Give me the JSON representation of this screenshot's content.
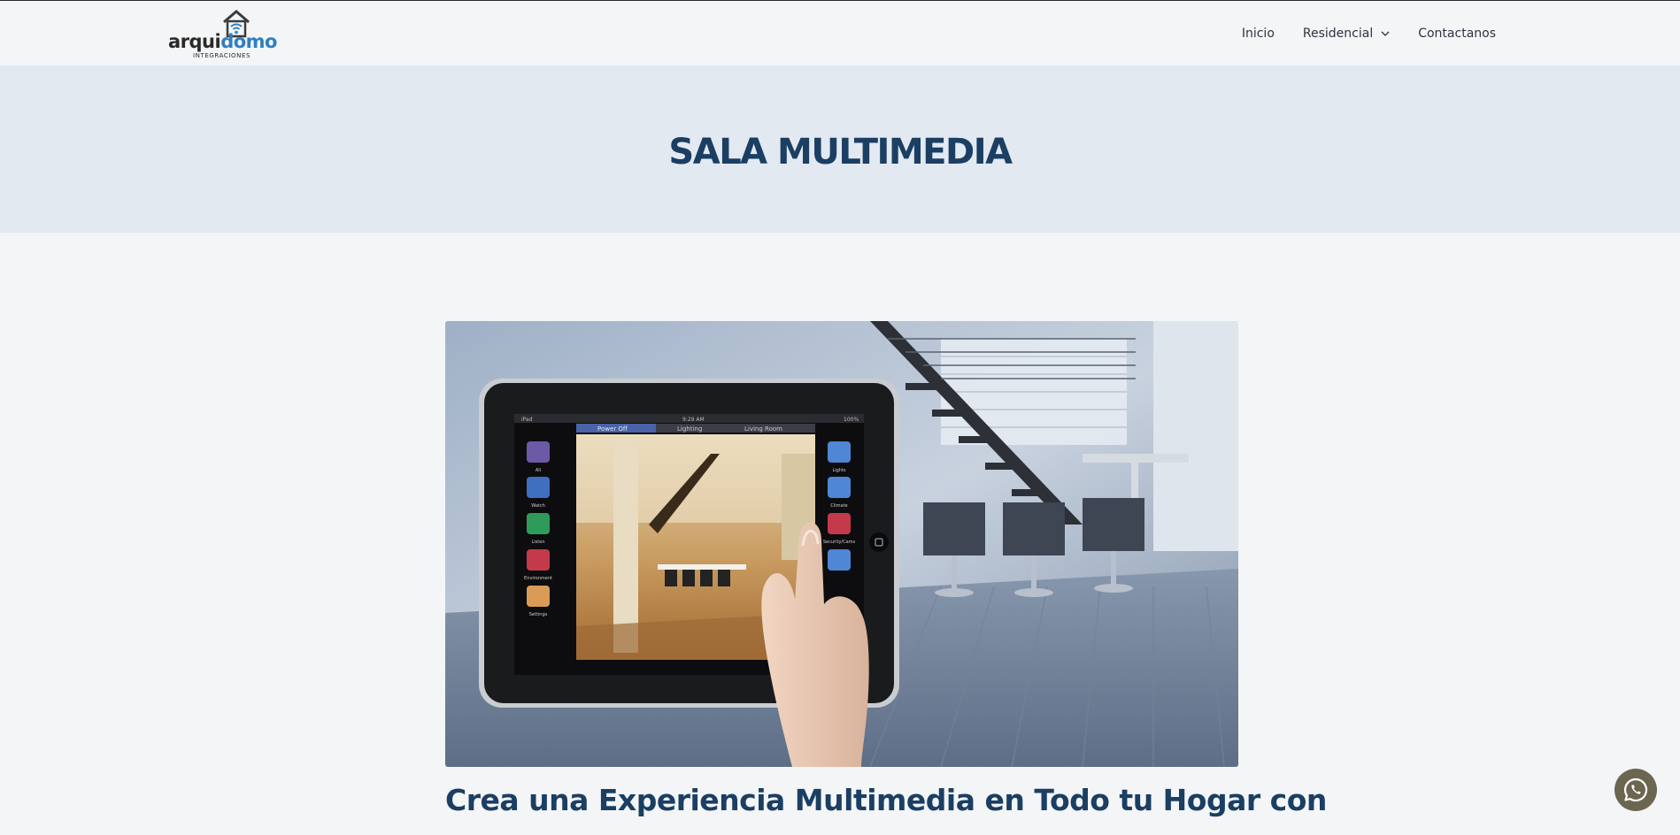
{
  "brand": {
    "name_part1": "arqui",
    "name_part2": "domo",
    "tagline": "INTEGRACIONES",
    "icon": "house-wifi-icon"
  },
  "nav": {
    "items": [
      {
        "label": "Inicio"
      },
      {
        "label": "Residencial",
        "has_dropdown": true
      },
      {
        "label": "Contactanos"
      }
    ]
  },
  "hero": {
    "title": "SALA MULTIMEDIA"
  },
  "featured_image": {
    "tablet_status_time": "9:29 AM",
    "tablet_status_battery": "100%",
    "tablet_tabs": [
      "Power Off",
      "Lighting",
      "Living Room"
    ],
    "tablet_left_icons": [
      "All",
      "Watch",
      "Listen",
      "Environment",
      "Settings"
    ],
    "tablet_right_icons": [
      "Lights",
      "Climate",
      "Security/Cams"
    ]
  },
  "article": {
    "title": "Crea una Experiencia Multimedia en Todo tu Hogar con"
  },
  "whatsapp": {
    "icon": "whatsapp-icon"
  },
  "colors": {
    "brand_blue": "#1b3e63",
    "logo_accent": "#2f7fc1",
    "hero_bg": "#e3e9f1",
    "page_bg": "#f3f5f7",
    "whatsapp_bg": "#6b6650"
  }
}
